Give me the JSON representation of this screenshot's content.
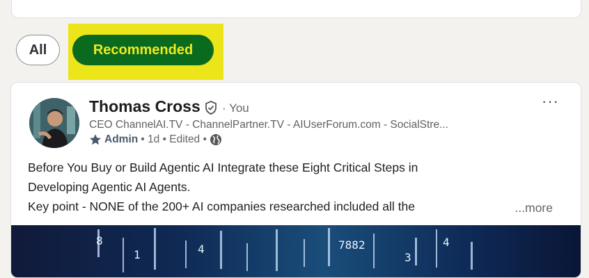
{
  "filters": {
    "all_label": "All",
    "recommended_label": "Recommended"
  },
  "post": {
    "author_name": "Thomas Cross",
    "you_label": "· You",
    "headline": "CEO ChannelAI.TV - ChannelPartner.TV - AIUserForum.com - SocialStre...",
    "admin_label": "Admin",
    "meta_suffix": "• 1d • Edited •",
    "more_menu": "···",
    "body_line_1": "Before You Buy or Build Agentic AI Integrate these Eight Critical Steps in",
    "body_line_2": "Developing Agentic AI Agents.",
    "body_line_3": "Key point - NONE of the 200+ AI companies researched included all the",
    "see_more": "...more",
    "image_text": "7882"
  },
  "colors": {
    "highlight": "#ece51a",
    "recommended_bg": "#0a6a1e",
    "recommended_text": "#f0ea1f",
    "page_bg": "#f4f2ee"
  },
  "icons": [
    "verified-shield-icon",
    "star-icon",
    "globe-icon",
    "more-options-icon"
  ]
}
